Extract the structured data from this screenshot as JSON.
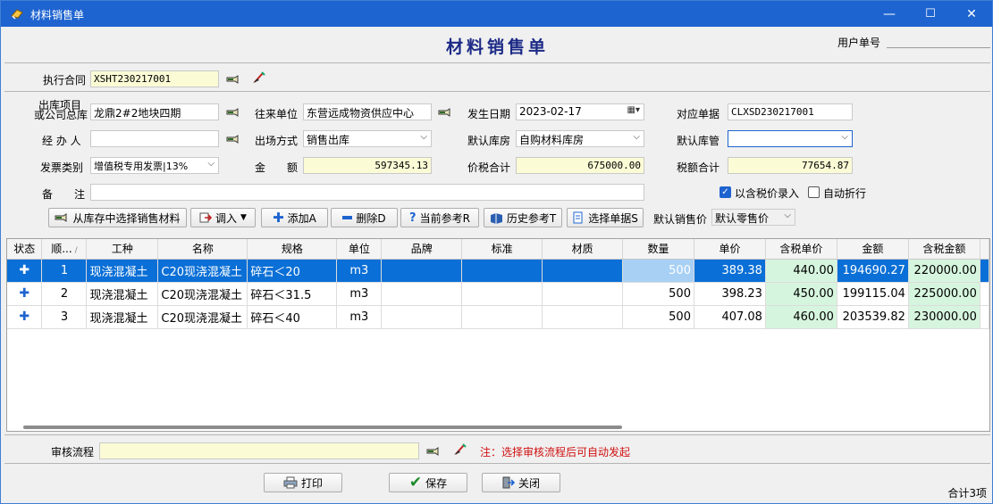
{
  "window": {
    "title": "材料销售单",
    "minimize": "—",
    "maximize": "☐",
    "close": "✕"
  },
  "header": {
    "title": "材料销售单",
    "user_no_label": "用户单号",
    "user_no_value": ""
  },
  "contract": {
    "label": "执行合同",
    "value": "XSHT230217001"
  },
  "form": {
    "project_label_1": "出库项目",
    "project_label_2": "或公司总库",
    "project_value": "龙鼎2#2地块四期",
    "partner_label": "往来单位",
    "partner_value": "东营远成物资供应中心",
    "date_label": "发生日期",
    "date_value": "2023-02-17",
    "ref_label": "对应单据",
    "ref_value": "CLXSD230217001",
    "handler_label": "经 办 人",
    "handler_value": "",
    "method_label": "出场方式",
    "method_value": "销售出库",
    "warehouse_label": "默认库房",
    "warehouse_value": "自购材料库房",
    "keeper_label": "默认库管",
    "keeper_value": "",
    "invoice_label": "发票类别",
    "invoice_value": "增值税专用发票|13%",
    "amount_label": "金　　额",
    "amount_value": "597345.13",
    "total_label": "价税合计",
    "total_value": "675000.00",
    "tax_label": "税额合计",
    "tax_value": "77654.87",
    "remark_label": "备　　注",
    "remark_value": "",
    "tax_inclusive_label": "以含税价录入",
    "tax_inclusive_checked": true,
    "auto_wrap_label": "自动折行",
    "auto_wrap_checked": false
  },
  "toolbar": {
    "select_stock": "从库存中选择销售材料",
    "import": "调入",
    "add": "添加A",
    "delete": "删除D",
    "current_ref": "当前参考R",
    "history_ref": "历史参考T",
    "select_doc": "选择单据S",
    "default_price_label": "默认销售价",
    "default_price_value": "默认零售价"
  },
  "grid": {
    "columns": [
      "状态",
      "顺...",
      "工种",
      "名称",
      "规格",
      "单位",
      "品牌",
      "标准",
      "材质",
      "数量",
      "单价",
      "含税单价",
      "金额",
      "含税金额"
    ],
    "rows": [
      {
        "seq": "1",
        "type": "现浇混凝土",
        "name": "C20现浇混凝土",
        "spec": "碎石＜20",
        "unit": "m3",
        "brand": "",
        "standard": "",
        "material": "",
        "qty": "500",
        "price": "389.38",
        "tax_price": "440.00",
        "amount": "194690.27",
        "tax_amount": "220000.00"
      },
      {
        "seq": "2",
        "type": "现浇混凝土",
        "name": "C20现浇混凝土",
        "spec": "碎石＜31.5",
        "unit": "m3",
        "brand": "",
        "standard": "",
        "material": "",
        "qty": "500",
        "price": "398.23",
        "tax_price": "450.00",
        "amount": "199115.04",
        "tax_amount": "225000.00"
      },
      {
        "seq": "3",
        "type": "现浇混凝土",
        "name": "C20现浇混凝土",
        "spec": "碎石＜40",
        "unit": "m3",
        "brand": "",
        "standard": "",
        "material": "",
        "qty": "500",
        "price": "407.08",
        "tax_price": "460.00",
        "amount": "203539.82",
        "tax_amount": "230000.00"
      }
    ]
  },
  "review": {
    "label": "审核流程",
    "value": "",
    "note": "注：选择审核流程后可自动发起"
  },
  "footer": {
    "print": "打印",
    "save": "保存",
    "close": "关闭",
    "summary": "合计3项"
  },
  "colors": {
    "titlebar": "#1e64d0",
    "selection": "#0a6fd6",
    "title_text": "#1c2a86",
    "note_red": "#d01010"
  }
}
